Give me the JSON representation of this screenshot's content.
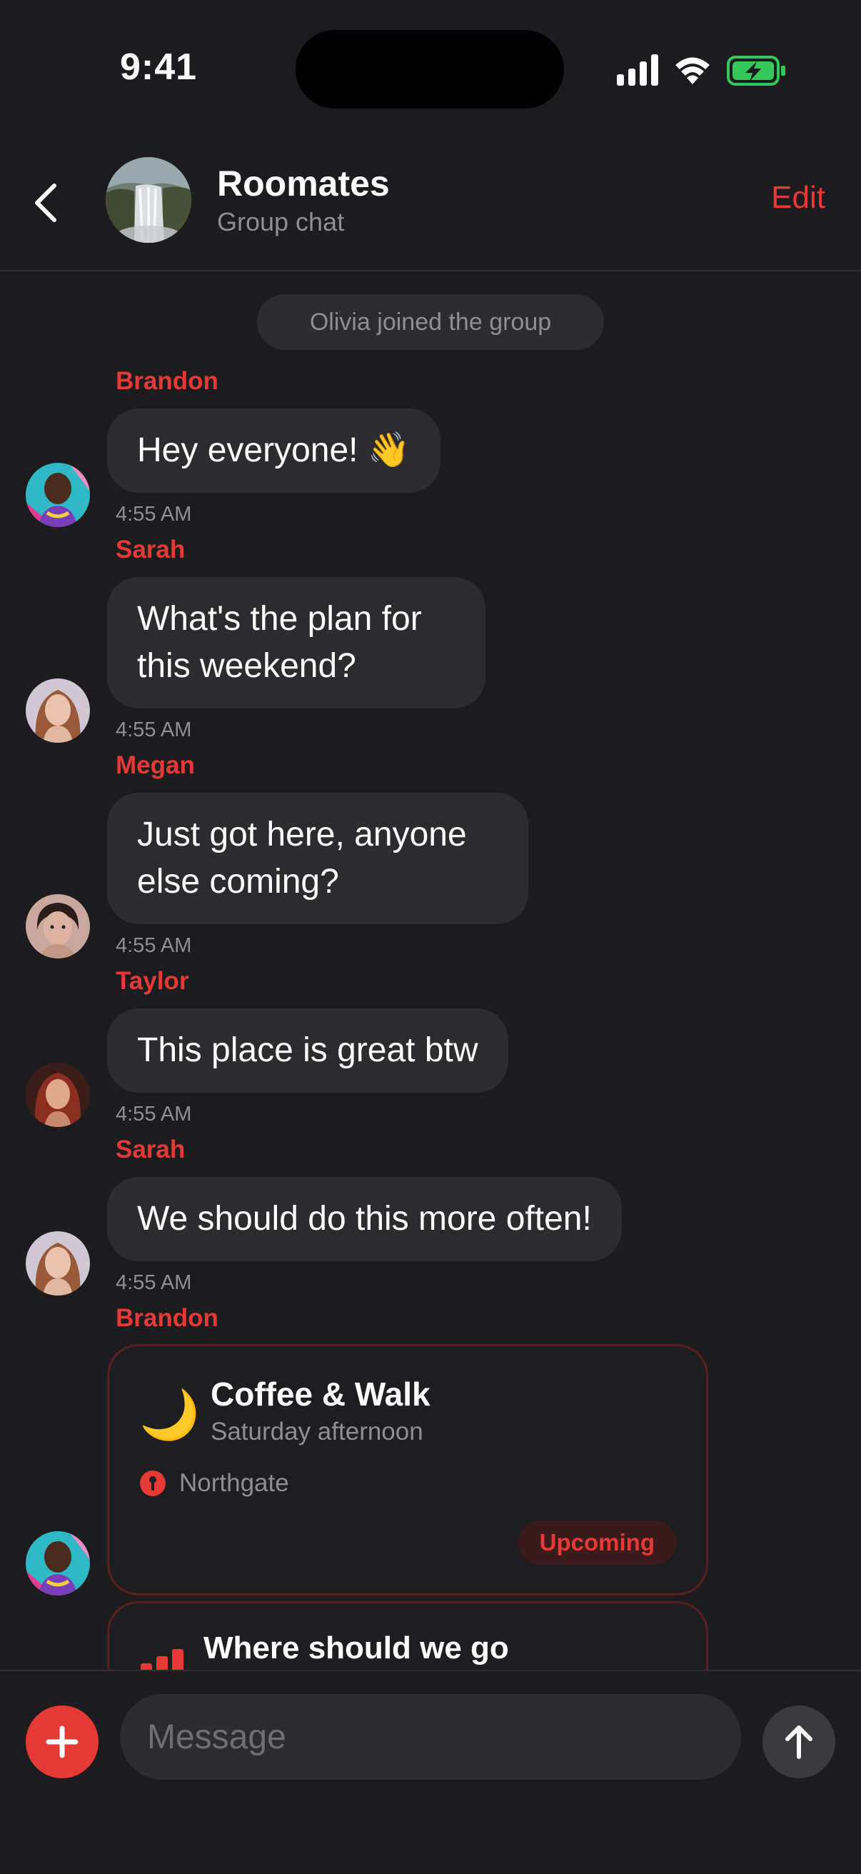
{
  "status_bar": {
    "time": "9:41",
    "battery_color": "#34c759"
  },
  "header": {
    "title": "Roomates",
    "subtitle": "Group chat",
    "edit_label": "Edit",
    "accent": "#e53935"
  },
  "system_message": "Olivia joined the group",
  "messages": [
    {
      "sender": "Brandon",
      "text": "Hey everyone! 👋",
      "time": "4:55 AM"
    },
    {
      "sender": "Sarah",
      "text": "What's the plan for this weekend?",
      "time": "4:55 AM"
    },
    {
      "sender": "Megan",
      "text": "Just got here, anyone else coming?",
      "time": "4:55 AM"
    },
    {
      "sender": "Taylor",
      "text": "This place is great btw",
      "time": "4:55 AM"
    },
    {
      "sender": "Sarah",
      "text": "We should do this more often!",
      "time": "4:55 AM"
    },
    {
      "sender": "Brandon"
    }
  ],
  "event_card": {
    "icon": "🌙",
    "title": "Coffee & Walk",
    "subtitle": "Saturday afternoon",
    "location": "Northgate",
    "status": "Upcoming"
  },
  "poll_card": {
    "title": "Where should we go"
  },
  "composer": {
    "placeholder": "Message"
  }
}
